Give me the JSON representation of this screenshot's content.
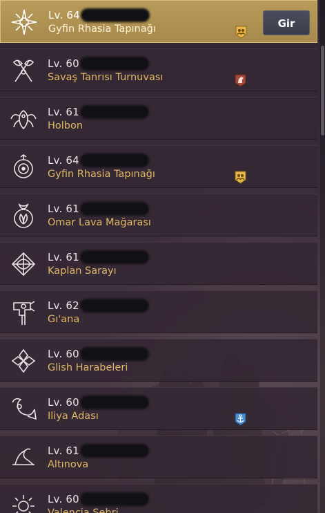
{
  "rows": [
    {
      "level": "Lv. 64",
      "name": "Gyfin Rhasia Tapınağı",
      "icon": "gyfin-compass-emblem",
      "badge": "party-badge",
      "selected": true
    },
    {
      "level": "Lv. 60",
      "name": "Savaş Tanrısı Turnuvası",
      "icon": "axes-emblem",
      "badge": "horse-badge",
      "selected": false
    },
    {
      "level": "Lv. 61",
      "name": "Holbon",
      "icon": "tentacle-emblem",
      "badge": "",
      "selected": false
    },
    {
      "level": "Lv. 64",
      "name": "Gyfin Rhasia Tapınağı",
      "icon": "ring-emblem",
      "badge": "party-badge",
      "selected": false
    },
    {
      "level": "Lv. 61",
      "name": "Omar Lava Mağarası",
      "icon": "lotus-emblem",
      "badge": "",
      "selected": false
    },
    {
      "level": "Lv. 61",
      "name": "Kaplan Sarayı",
      "icon": "bow-emblem",
      "badge": "",
      "selected": false
    },
    {
      "level": "Lv. 62",
      "name": "Gı'ana",
      "icon": "mace-emblem",
      "badge": "",
      "selected": false
    },
    {
      "level": "Lv. 60",
      "name": "Glish Harabeleri",
      "icon": "cross-emblem",
      "badge": "",
      "selected": false
    },
    {
      "level": "Lv. 60",
      "name": "Iliya Adası",
      "icon": "horn-emblem",
      "badge": "anchor-badge",
      "selected": false
    },
    {
      "level": "Lv. 61",
      "name": "Altınova",
      "icon": "wave-emblem",
      "badge": "",
      "selected": false
    },
    {
      "level": "Lv. 60",
      "name": "Valencia Şehri",
      "icon": "sun-emblem",
      "badge": "",
      "selected": false
    }
  ],
  "enter_button": {
    "label": "Gir"
  },
  "colors": {
    "selected_row": "#b89b5a",
    "row_bg": "#342834",
    "name_text": "#e0b866",
    "party_badge": "#e8b64a",
    "horse_badge": "#a44a3a",
    "anchor_badge": "#4a8ccc"
  }
}
